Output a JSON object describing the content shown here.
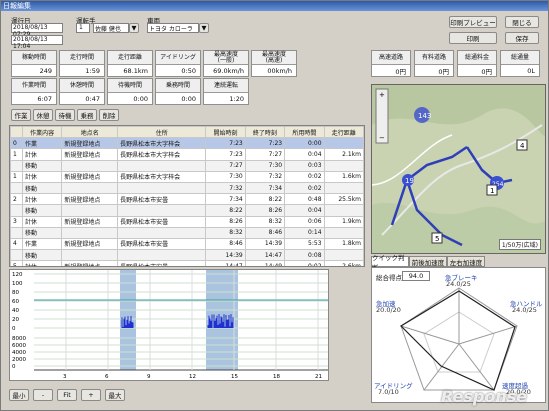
{
  "window": {
    "title": "日報編集"
  },
  "top": {
    "start_label": "運行日",
    "start_date": "2018/08/13 07:29",
    "end_date": "2018/08/13 17:04",
    "driver_label": "運転手",
    "driver_id": "1",
    "driver_name": "佐藤 健也",
    "vehicle_label": "車両",
    "vehicle_name": "トヨタ カローラ"
  },
  "actions": {
    "preview": "印刷プレビュー",
    "print": "印刷",
    "close": "閉じる",
    "save": "保存"
  },
  "stats1": [
    {
      "h": "稼動時間",
      "v": "249"
    },
    {
      "h": "走行時間",
      "v": "1:59"
    },
    {
      "h": "走行距離",
      "v": "68.1km"
    },
    {
      "h": "アイドリング",
      "v": "0:50"
    },
    {
      "h": "最高速度\n(一般)",
      "v": "69.0km/h"
    },
    {
      "h": "最高速度\n(高速)",
      "v": "00km/h"
    }
  ],
  "stats2": [
    {
      "h": "作業時間",
      "v": "6:07"
    },
    {
      "h": "休憩時間",
      "v": "0:47"
    },
    {
      "h": "待機時間",
      "v": "0:00"
    },
    {
      "h": "乗務時間",
      "v": "0:00"
    },
    {
      "h": "連続運転",
      "v": "1:20"
    }
  ],
  "fees": [
    {
      "h": "高速道路",
      "v": "0円"
    },
    {
      "h": "有料道路",
      "v": "0円"
    },
    {
      "h": "総通料金",
      "v": "0円"
    },
    {
      "h": "総通量",
      "v": "0L"
    }
  ],
  "toolbar": [
    "作業",
    "休憩",
    "待機",
    "乗務",
    "削除"
  ],
  "table": {
    "headers": [
      "",
      "作業内容",
      "地点名",
      "住所",
      "開始時刻",
      "終了時刻",
      "所用時間",
      "走行距離"
    ],
    "rows": [
      [
        "0",
        "作業",
        "新規登録地点",
        "長野県松本市大字梓会",
        "7:23",
        "7:23",
        "0:00",
        ""
      ],
      [
        "1",
        "計休",
        "新規登録地点",
        "長野県松本市大字梓会",
        "7:23",
        "7:27",
        "0:04",
        "2.1km"
      ],
      [
        "",
        "移動",
        "",
        "",
        "7:27",
        "7:30",
        "0:03",
        ""
      ],
      [
        "1",
        "計休",
        "新規登録地点",
        "長野県松本市大字梓会",
        "7:30",
        "7:32",
        "0:02",
        "1.6km"
      ],
      [
        "",
        "移動",
        "",
        "",
        "7:32",
        "7:34",
        "0:02",
        ""
      ],
      [
        "2",
        "計休",
        "新規登録地点",
        "長野県松本市安曇",
        "7:34",
        "8:22",
        "0:48",
        "25.5km"
      ],
      [
        "",
        "移動",
        "",
        "",
        "8:22",
        "8:26",
        "0:04",
        ""
      ],
      [
        "3",
        "計休",
        "新規登録地点",
        "長野県松本市安曇",
        "8:26",
        "8:32",
        "0:06",
        "1.9km"
      ],
      [
        "",
        "移動",
        "",
        "",
        "8:32",
        "8:46",
        "0:14",
        ""
      ],
      [
        "4",
        "作業",
        "新規登録地点",
        "長野県松本市安曇",
        "8:46",
        "14:39",
        "5:53",
        "1.8km"
      ],
      [
        "",
        "移動",
        "",
        "",
        "14:39",
        "14:47",
        "0:08",
        ""
      ],
      [
        "5",
        "計休",
        "新規登録地点",
        "長野県松本市安曇",
        "14:47",
        "14:49",
        "0:02",
        "2.6km"
      ],
      [
        "",
        "移動",
        "",
        "",
        "14:49",
        "15:59",
        "1:10",
        "26.7km"
      ]
    ]
  },
  "zoom": {
    "min": "最小",
    "minus": "-",
    "fit": "Fit",
    "plus": "+",
    "max": "最大"
  },
  "chart": {
    "y1": [
      "120",
      "100",
      "80",
      "60",
      "40",
      "20",
      "0"
    ],
    "y2": [
      "8000",
      "6000",
      "4000",
      "2000",
      "0"
    ],
    "x": [
      "3",
      "6",
      "9",
      "12",
      "15",
      "18",
      "21"
    ]
  },
  "chart_data": {
    "type": "bar",
    "title": "",
    "xlabel": "",
    "ylabel": "",
    "x": [
      "3",
      "6",
      "9",
      "12",
      "15",
      "18",
      "21"
    ],
    "ylim": [
      0,
      120
    ],
    "series": []
  },
  "map": {
    "scale": "1/50万(広域)"
  },
  "tabs": [
    "クイック判断",
    "前後加速度",
    "左右加速度"
  ],
  "radar": {
    "score_label": "総合得点",
    "score": "94.0",
    "axes": [
      {
        "name": "急ブレーキ",
        "val": "24.0/25"
      },
      {
        "name": "急ハンドル",
        "val": "24.0/25"
      },
      {
        "name": "速度超過",
        "val": "20.0/20"
      },
      {
        "name": "アイドリング",
        "val": "7.0/10"
      },
      {
        "name": "急加速",
        "val": "20.0/20"
      }
    ]
  },
  "watermark": "Response"
}
